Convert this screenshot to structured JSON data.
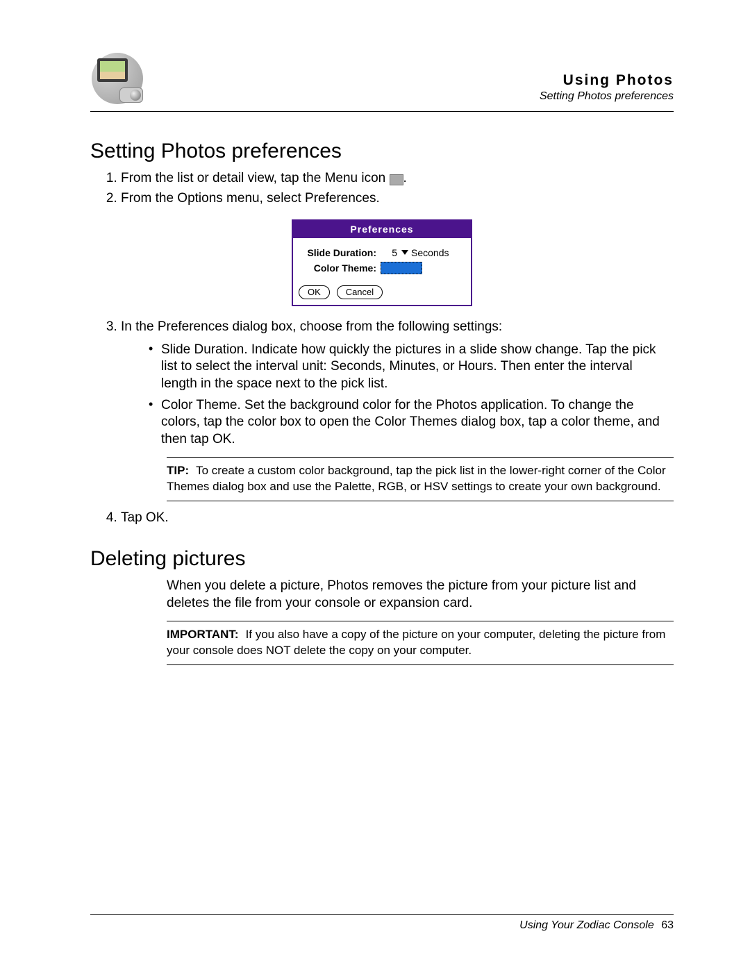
{
  "header": {
    "chapter": "Using Photos",
    "section": "Setting Photos preferences"
  },
  "section1": {
    "title": "Setting Photos preferences",
    "step1_a": "From the list or detail view, tap the Menu icon ",
    "step1_b": ".",
    "step2": "From the Options menu, select Preferences.",
    "step3": "In the Preferences dialog box, choose from the following settings:",
    "bullet1": "Slide Duration. Indicate how quickly the pictures in a slide show change. Tap the pick list to select the interval unit: Seconds, Minutes, or Hours. Then enter the interval length in the space next to the pick list.",
    "bullet2": "Color Theme. Set the background color for the Photos application. To change the colors, tap the color box to open the Color Themes dialog box, tap a color theme, and then tap OK.",
    "tip_label": "TIP:",
    "tip_body": "To create a custom color background, tap the pick list in the lower-right corner of the Color Themes dialog box and use the Palette, RGB, or HSV settings to create your own background.",
    "step4": "Tap OK."
  },
  "prefs_dialog": {
    "title": "Preferences",
    "slide_label": "Slide Duration:",
    "slide_value": "5",
    "slide_unit": "Seconds",
    "color_label": "Color Theme:",
    "ok": "OK",
    "cancel": "Cancel"
  },
  "section2": {
    "title": "Deleting pictures",
    "intro": "When you delete a picture, Photos removes the picture from your picture list and deletes the file from your console or expansion card.",
    "important_label": "IMPORTANT:",
    "important_body": "If you also have a copy of the picture on your computer, deleting the picture from your console does NOT delete the copy on your computer."
  },
  "footer": {
    "doc": "Using Your Zodiac Console",
    "page": "63"
  }
}
